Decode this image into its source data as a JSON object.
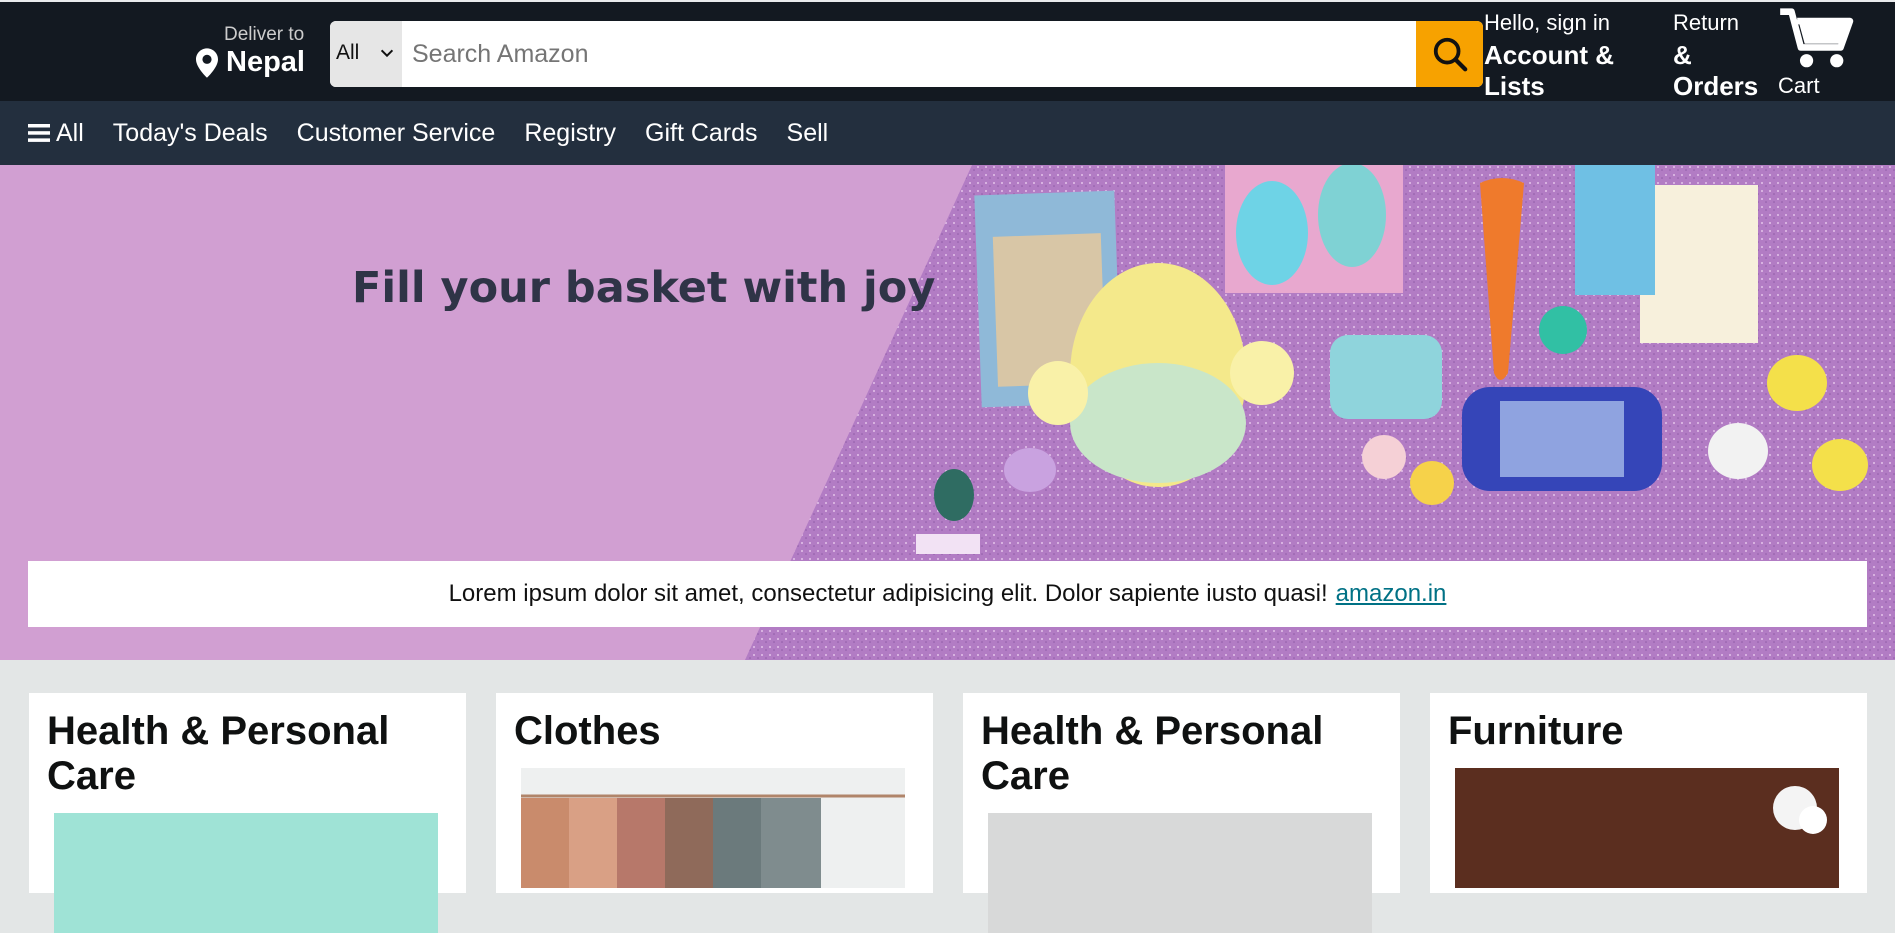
{
  "header": {
    "deliver_to": "Deliver to",
    "location": "Nepal",
    "search": {
      "category": "All",
      "placeholder": "Search Amazon"
    },
    "account": {
      "greeting": "Hello, sign in",
      "label": "Account & Lists"
    },
    "returns": {
      "line1": "Return",
      "line2": "& Orders"
    },
    "cart_label": "Cart"
  },
  "subnav": {
    "all": "All",
    "items": [
      "Today's Deals",
      "Customer Service",
      "Registry",
      "Gift Cards",
      "Sell"
    ]
  },
  "hero": {
    "headline": "Fill your basket with joy",
    "notice_text": "Lorem ipsum dolor sit amet, consectetur adipisicing elit. Dolor sapiente iusto quasi!",
    "notice_link": "amazon.in"
  },
  "cards": [
    {
      "title": "Health & Personal Care",
      "image": "health-personal-care-image"
    },
    {
      "title": "Clothes",
      "image": "clothes-image"
    },
    {
      "title": "Health & Personal Care",
      "image": "health-personal-care-image"
    },
    {
      "title": "Furniture",
      "image": "furniture-image"
    }
  ],
  "colors": {
    "nav_bg": "#131921",
    "subnav_bg": "#232f3e",
    "search_button": "#f7a200",
    "hero_bg": "#d19fd2",
    "link": "#007185"
  }
}
